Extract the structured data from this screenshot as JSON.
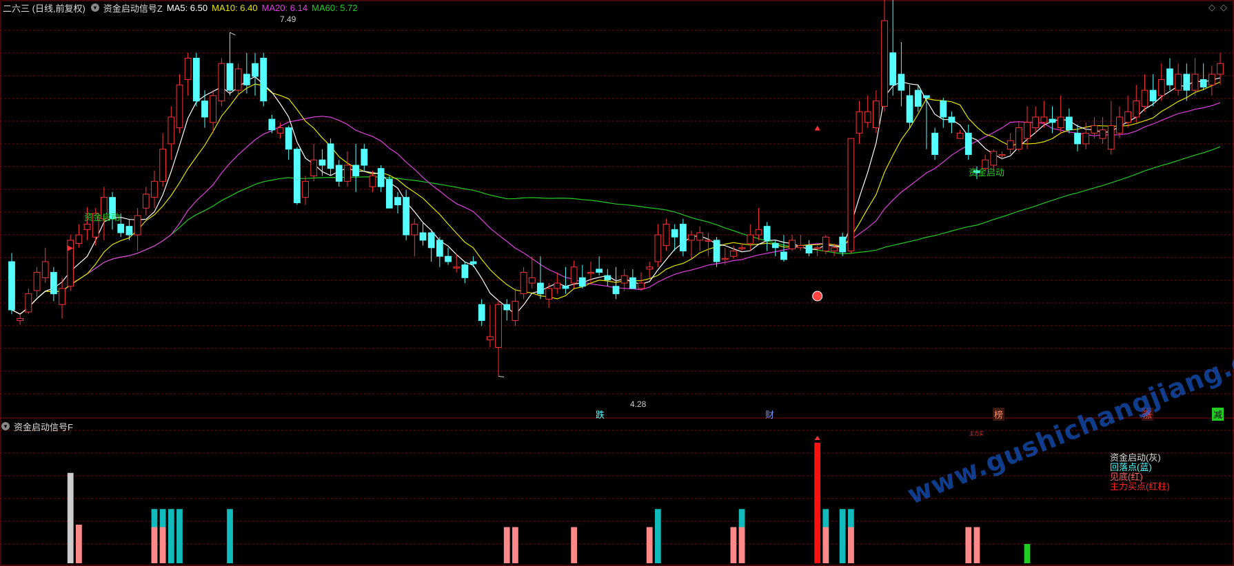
{
  "main_panel": {
    "title": "二六三 (日线,前复权)",
    "indicator_name": "资金启动信号Z",
    "ma5": "MA5: 6.50",
    "ma10": "MA10: 6.40",
    "ma20": "MA20: 6.14",
    "ma60": "MA60: 5.72",
    "high_label": "7.49",
    "low_label": "4.28",
    "signal_labels": [
      "资金启动",
      "资金启动"
    ],
    "bottom_markers": [
      "跌",
      "财",
      "榜",
      "涨",
      "减"
    ],
    "colors": {
      "ma5": "#ffffff",
      "ma10": "#e6e600",
      "ma20": "#e040e0",
      "ma60": "#22cc22",
      "up": "#ff3333",
      "down": "#55ffff"
    }
  },
  "sub_panel": {
    "title": "资金启动信号F",
    "legend": [
      "资金启动(灰)",
      "回落点(蓝)",
      "见底(红)",
      "主力买点(红柱)"
    ],
    "small_tag": "主力买"
  },
  "watermark": "www.gushichangjiang.com",
  "corner_icons": [
    "diamond-icon",
    "diamond-icon"
  ],
  "chart_data": {
    "type": "candlestick",
    "price_range": [
      4.0,
      7.6
    ],
    "candles": [
      [
        5.35,
        4.9,
        5.43,
        4.86
      ],
      [
        4.8,
        4.82,
        4.86,
        4.76
      ],
      [
        4.88,
        5.05,
        5.1,
        4.86
      ],
      [
        5.08,
        5.25,
        5.3,
        5.02
      ],
      [
        5.2,
        5.35,
        5.48,
        5.15
      ],
      [
        5.25,
        5.05,
        5.3,
        4.98
      ],
      [
        4.95,
        5.1,
        5.2,
        4.82
      ],
      [
        5.12,
        5.55,
        5.6,
        5.08
      ],
      [
        5.52,
        5.6,
        5.7,
        5.48
      ],
      [
        5.65,
        5.7,
        5.86,
        5.55
      ],
      [
        5.58,
        5.8,
        5.85,
        5.5
      ],
      [
        5.75,
        5.95,
        6.05,
        5.55
      ],
      [
        5.95,
        5.75,
        6.0,
        5.65
      ],
      [
        5.7,
        5.62,
        5.8,
        5.58
      ],
      [
        5.68,
        5.6,
        5.75,
        5.55
      ],
      [
        5.6,
        5.78,
        5.85,
        5.45
      ],
      [
        5.85,
        5.98,
        6.05,
        5.78
      ],
      [
        5.95,
        6.1,
        6.2,
        5.85
      ],
      [
        6.1,
        6.4,
        6.55,
        6.05
      ],
      [
        6.45,
        6.7,
        6.8,
        6.3
      ],
      [
        6.6,
        7.0,
        7.1,
        6.55
      ],
      [
        7.05,
        7.25,
        7.3,
        6.9
      ],
      [
        7.25,
        6.85,
        7.3,
        6.8
      ],
      [
        6.85,
        6.7,
        6.95,
        6.6
      ],
      [
        6.65,
        6.9,
        6.95,
        6.55
      ],
      [
        6.85,
        7.2,
        7.25,
        6.8
      ],
      [
        7.2,
        6.95,
        7.49,
        6.9
      ],
      [
        6.95,
        7.15,
        7.2,
        6.9
      ],
      [
        7.1,
        7.0,
        7.3,
        6.92
      ],
      [
        7.2,
        7.08,
        7.3,
        6.9
      ],
      [
        7.25,
        6.85,
        7.3,
        6.8
      ],
      [
        6.68,
        6.58,
        6.72,
        6.55
      ],
      [
        6.55,
        6.6,
        6.65,
        6.5
      ],
      [
        6.6,
        6.4,
        6.62,
        6.3
      ],
      [
        6.4,
        5.9,
        6.42,
        5.88
      ],
      [
        5.95,
        6.1,
        6.15,
        5.88
      ],
      [
        6.15,
        6.3,
        6.45,
        6.1
      ],
      [
        6.3,
        6.25,
        6.4,
        6.15
      ],
      [
        6.45,
        6.22,
        6.5,
        6.15
      ],
      [
        6.25,
        6.1,
        6.3,
        6.05
      ],
      [
        6.1,
        6.25,
        6.38,
        6.05
      ],
      [
        6.25,
        6.15,
        6.45,
        6.0
      ],
      [
        6.4,
        6.25,
        6.45,
        6.2
      ],
      [
        6.05,
        6.15,
        6.2,
        6.0
      ],
      [
        6.22,
        6.05,
        6.25,
        6.0
      ],
      [
        6.12,
        5.85,
        6.15,
        5.85
      ],
      [
        5.95,
        5.88,
        6.0,
        5.8
      ],
      [
        5.95,
        5.6,
        6.02,
        5.55
      ],
      [
        5.6,
        5.7,
        5.75,
        5.4
      ],
      [
        5.62,
        5.55,
        5.72,
        5.5
      ],
      [
        5.62,
        5.48,
        5.65,
        5.35
      ],
      [
        5.55,
        5.4,
        5.58,
        5.3
      ],
      [
        5.4,
        5.35,
        5.48,
        5.32
      ],
      [
        5.3,
        5.3,
        5.42,
        5.25
      ],
      [
        5.32,
        5.2,
        5.35,
        5.15
      ],
      [
        5.35,
        5.33,
        5.4,
        5.3
      ],
      [
        4.95,
        4.8,
        5.0,
        4.75
      ],
      [
        4.62,
        4.65,
        4.95,
        4.55
      ],
      [
        4.55,
        4.95,
        4.99,
        4.28
      ],
      [
        4.95,
        4.9,
        5.0,
        4.8
      ],
      [
        4.8,
        4.98,
        5.1,
        4.75
      ],
      [
        5.05,
        5.25,
        5.3,
        5.0
      ],
      [
        5.15,
        5.2,
        5.4,
        5.1
      ],
      [
        5.15,
        5.05,
        5.4,
        5.0
      ],
      [
        5.0,
        5.1,
        5.15,
        4.92
      ],
      [
        5.1,
        5.15,
        5.25,
        5.05
      ],
      [
        5.12,
        5.1,
        5.3,
        5.05
      ],
      [
        5.15,
        5.3,
        5.36,
        5.1
      ],
      [
        5.2,
        5.12,
        5.32,
        5.1
      ],
      [
        5.25,
        5.25,
        5.35,
        5.15
      ],
      [
        5.28,
        5.25,
        5.4,
        5.22
      ],
      [
        5.22,
        5.18,
        5.28,
        5.12
      ],
      [
        5.12,
        5.05,
        5.3,
        5.0
      ],
      [
        5.15,
        5.22,
        5.28,
        5.08
      ],
      [
        5.2,
        5.1,
        5.28,
        5.1
      ],
      [
        5.1,
        5.15,
        5.25,
        5.08
      ],
      [
        5.28,
        5.3,
        5.35,
        5.2
      ],
      [
        5.35,
        5.6,
        5.7,
        5.3
      ],
      [
        5.5,
        5.7,
        5.75,
        5.45
      ],
      [
        5.65,
        5.58,
        5.7,
        5.45
      ],
      [
        5.7,
        5.45,
        5.75,
        5.4
      ],
      [
        5.55,
        5.6,
        5.64,
        5.38
      ],
      [
        5.55,
        5.62,
        5.68,
        5.45
      ],
      [
        5.55,
        5.55,
        5.62,
        5.4
      ],
      [
        5.55,
        5.35,
        5.58,
        5.3
      ],
      [
        5.38,
        5.38,
        5.48,
        5.32
      ],
      [
        5.4,
        5.45,
        5.5,
        5.38
      ],
      [
        5.48,
        5.48,
        5.52,
        5.45
      ],
      [
        5.52,
        5.6,
        5.7,
        5.45
      ],
      [
        5.6,
        5.65,
        5.85,
        5.55
      ],
      [
        5.68,
        5.55,
        5.72,
        5.45
      ],
      [
        5.52,
        5.48,
        5.55,
        5.4
      ],
      [
        5.44,
        5.37,
        5.6,
        5.35
      ],
      [
        5.47,
        5.55,
        5.6,
        5.45
      ],
      [
        5.48,
        5.5,
        5.6,
        5.45
      ],
      [
        5.5,
        5.43,
        5.55,
        5.4
      ],
      [
        5.48,
        5.48,
        5.5,
        5.4
      ],
      [
        5.45,
        5.58,
        5.6,
        5.42
      ],
      [
        5.45,
        5.48,
        5.52,
        5.4
      ],
      [
        5.58,
        5.44,
        5.62,
        5.4
      ],
      [
        5.45,
        6.5,
        6.5,
        5.43
      ],
      [
        6.55,
        6.75,
        6.85,
        6.45
      ],
      [
        6.65,
        6.75,
        6.9,
        6.6
      ],
      [
        6.6,
        6.85,
        6.95,
        6.55
      ],
      [
        6.8,
        7.6,
        7.8,
        6.75
      ],
      [
        7.3,
        7.0,
        7.8,
        6.9
      ],
      [
        7.1,
        6.95,
        7.4,
        6.8
      ],
      [
        6.9,
        6.65,
        7.0,
        6.6
      ],
      [
        6.95,
        6.8,
        7.0,
        6.75
      ],
      [
        6.9,
        6.88,
        6.9,
        6.4
      ],
      [
        6.55,
        6.35,
        6.6,
        6.3
      ],
      [
        6.85,
        6.7,
        6.88,
        6.6
      ],
      [
        6.7,
        6.65,
        6.75,
        6.55
      ],
      [
        6.5,
        6.55,
        6.58,
        6.5
      ],
      [
        6.55,
        6.35,
        6.63,
        6.3
      ],
      [
        6.2,
        6.18,
        6.24,
        6.12
      ],
      [
        6.22,
        6.3,
        6.35,
        6.2
      ],
      [
        6.25,
        6.38,
        6.4,
        6.2
      ],
      [
        6.35,
        6.35,
        6.38,
        6.3
      ],
      [
        6.4,
        6.48,
        6.55,
        6.35
      ],
      [
        6.4,
        6.6,
        6.65,
        6.38
      ],
      [
        6.5,
        6.65,
        6.8,
        6.4
      ],
      [
        6.6,
        6.7,
        6.8,
        6.55
      ],
      [
        6.65,
        6.7,
        6.85,
        6.6
      ],
      [
        6.68,
        6.65,
        6.8,
        6.55
      ],
      [
        6.6,
        6.7,
        6.9,
        6.55
      ],
      [
        6.7,
        6.58,
        6.78,
        6.55
      ],
      [
        6.55,
        6.45,
        6.63,
        6.38
      ],
      [
        6.45,
        6.55,
        6.65,
        6.4
      ],
      [
        6.55,
        6.62,
        6.7,
        6.5
      ],
      [
        6.5,
        6.58,
        6.7,
        6.45
      ],
      [
        6.4,
        6.62,
        6.85,
        6.35
      ],
      [
        6.55,
        6.7,
        6.8,
        6.5
      ],
      [
        6.65,
        6.75,
        6.9,
        6.6
      ],
      [
        6.7,
        6.85,
        7.0,
        6.65
      ],
      [
        6.8,
        6.95,
        7.1,
        6.75
      ],
      [
        6.95,
        6.85,
        7.1,
        6.8
      ],
      [
        6.9,
        7.05,
        7.2,
        6.85
      ],
      [
        7.15,
        7.0,
        7.25,
        6.95
      ],
      [
        6.95,
        7.1,
        7.2,
        6.9
      ],
      [
        7.1,
        6.95,
        7.2,
        6.85
      ],
      [
        6.95,
        7.1,
        7.25,
        6.9
      ],
      [
        7.05,
        6.98,
        7.2,
        6.95
      ],
      [
        7.0,
        7.1,
        7.18,
        6.9
      ],
      [
        7.1,
        7.2,
        7.3,
        7.0
      ]
    ],
    "sub_bars": [
      {
        "i": 8,
        "c": "pink",
        "h": 0.32
      },
      {
        "i": 7,
        "c": "gray",
        "h": 0.75
      },
      {
        "i": 17,
        "c": "cyan",
        "h": 0.45
      },
      {
        "i": 17,
        "c": "pink",
        "h": 0.3
      },
      {
        "i": 18,
        "c": "cyan",
        "h": 0.45
      },
      {
        "i": 18,
        "c": "pink",
        "h": 0.3
      },
      {
        "i": 19,
        "c": "cyan",
        "h": 0.45
      },
      {
        "i": 20,
        "c": "cyan",
        "h": 0.45
      },
      {
        "i": 26,
        "c": "cyan",
        "h": 0.45
      },
      {
        "i": 59,
        "c": "pink",
        "h": 0.3
      },
      {
        "i": 60,
        "c": "pink",
        "h": 0.3
      },
      {
        "i": 67,
        "c": "pink",
        "h": 0.3
      },
      {
        "i": 76,
        "c": "pink",
        "h": 0.3
      },
      {
        "i": 77,
        "c": "cyan",
        "h": 0.45
      },
      {
        "i": 86,
        "c": "pink",
        "h": 0.3
      },
      {
        "i": 87,
        "c": "cyan",
        "h": 0.45
      },
      {
        "i": 87,
        "c": "pink",
        "h": 0.3
      },
      {
        "i": 96,
        "c": "red",
        "h": 1.0
      },
      {
        "i": 97,
        "c": "cyan",
        "h": 0.45
      },
      {
        "i": 97,
        "c": "pink",
        "h": 0.3
      },
      {
        "i": 99,
        "c": "cyan",
        "h": 0.45
      },
      {
        "i": 100,
        "c": "cyan",
        "h": 0.45
      },
      {
        "i": 100,
        "c": "pink",
        "h": 0.3
      },
      {
        "i": 114,
        "c": "pink",
        "h": 0.3
      },
      {
        "i": 115,
        "c": "pink",
        "h": 0.3
      },
      {
        "i": 121,
        "c": "green",
        "h": 0.16
      }
    ],
    "series": [
      {
        "name": "MA5"
      },
      {
        "name": "MA10"
      },
      {
        "name": "MA20"
      },
      {
        "name": "MA60"
      }
    ]
  }
}
